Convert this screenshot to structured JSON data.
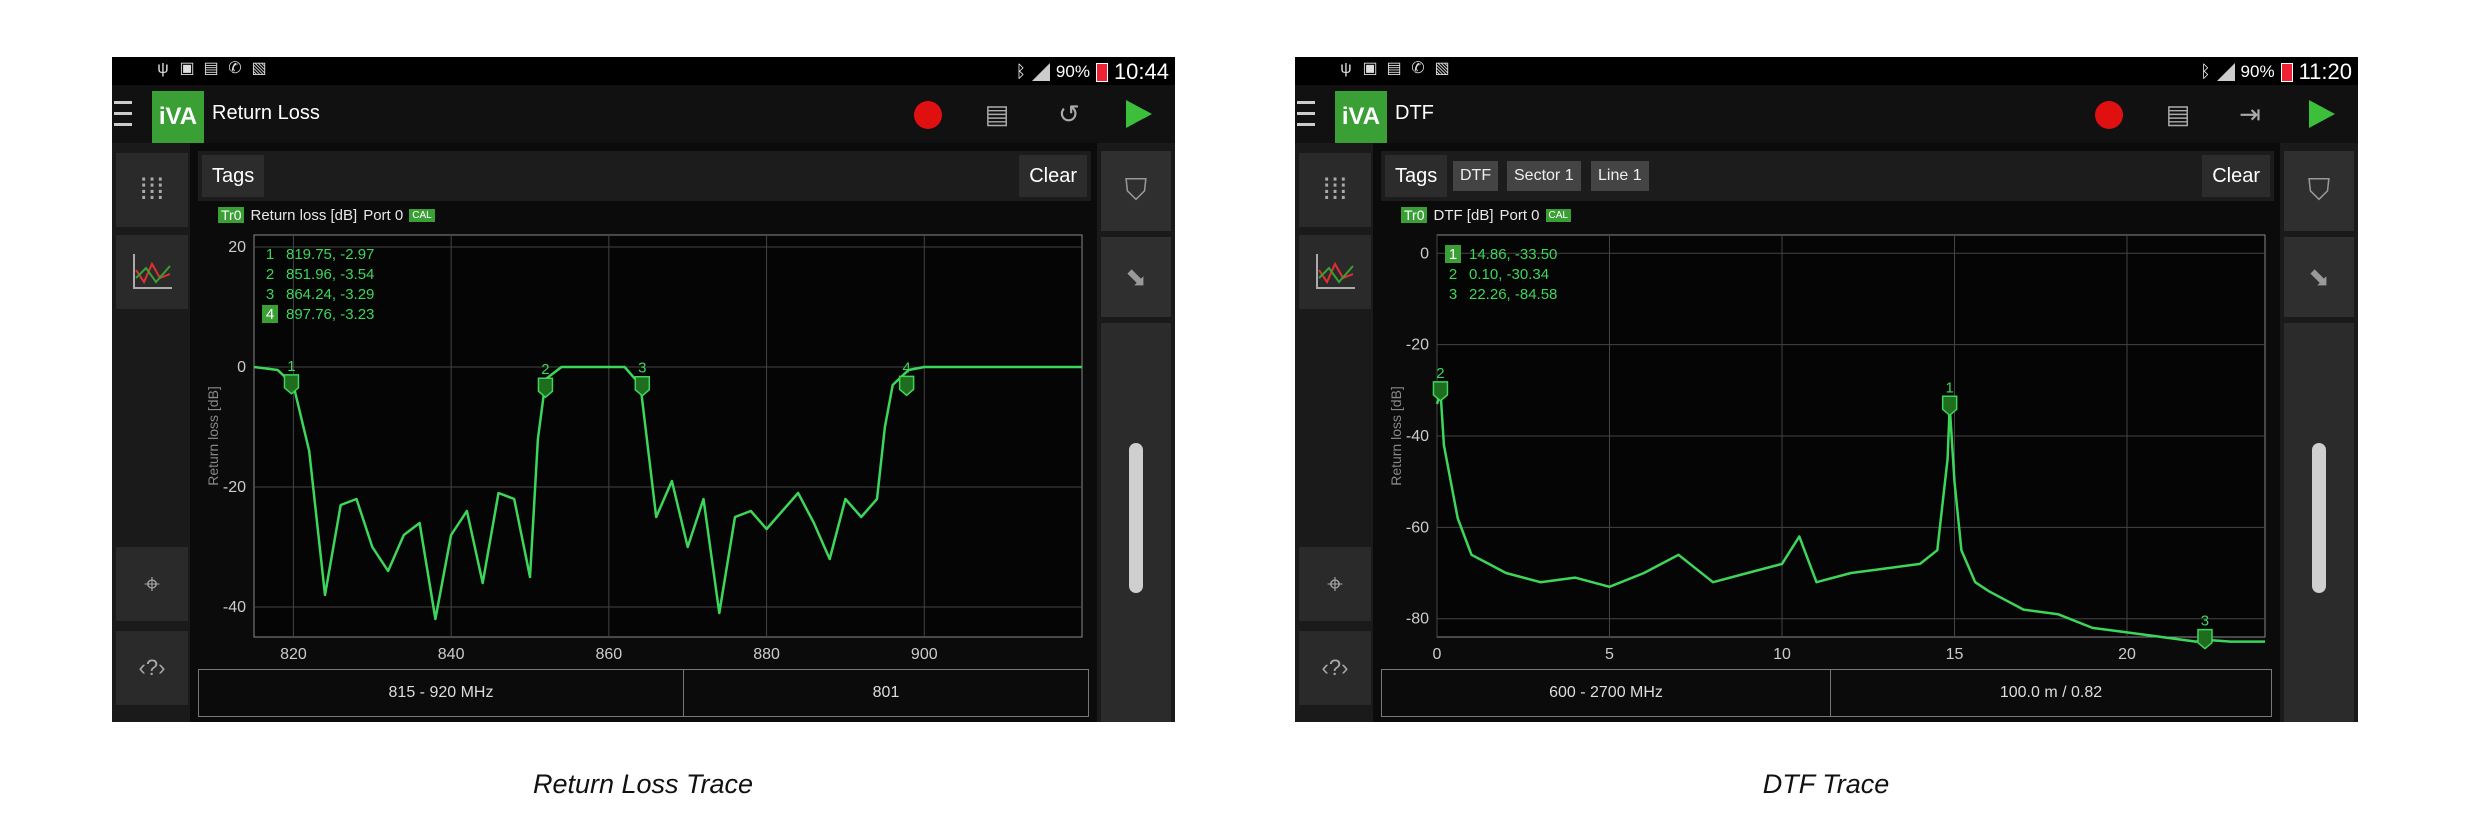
{
  "screens": [
    {
      "status": {
        "battery": "90%",
        "time": "10:44"
      },
      "title": "Return Loss",
      "tags_label": "Tags",
      "chips": [],
      "clear_label": "Clear",
      "trace_id": "Tr0",
      "trace_desc": "Return loss [dB]",
      "port": "Port 0",
      "cal": "CAL",
      "ylabel": "Return loss [dB]",
      "markers": [
        {
          "n": "1",
          "text": "819.75, -2.97",
          "active": false
        },
        {
          "n": "2",
          "text": "851.96, -3.54",
          "active": false
        },
        {
          "n": "3",
          "text": "864.24, -3.29",
          "active": false
        },
        {
          "n": "4",
          "text": "897.76, -3.23",
          "active": true
        }
      ],
      "freq_range": "815 - 920 MHz",
      "points": "801",
      "caption": "Return Loss Trace",
      "icons": [
        "menu-icon",
        "app-logo",
        "record-icon",
        "data-icon",
        "history-icon",
        "play-icon"
      ]
    },
    {
      "status": {
        "battery": "90%",
        "time": "11:20"
      },
      "title": "DTF",
      "tags_label": "Tags",
      "chips": [
        "DTF",
        "Sector 1",
        "Line 1"
      ],
      "clear_label": "Clear",
      "trace_id": "Tr0",
      "trace_desc": "DTF [dB]",
      "port": "Port 0",
      "cal": "CAL",
      "ylabel": "Return loss [dB]",
      "markers": [
        {
          "n": "1",
          "text": "14.86, -33.50",
          "active": true
        },
        {
          "n": "2",
          "text": "0.10, -30.34",
          "active": false
        },
        {
          "n": "3",
          "text": "22.26, -84.58",
          "active": false
        }
      ],
      "freq_range": "600 - 2700 MHz",
      "points": "100.0 m / 0.82",
      "caption": "DTF Trace",
      "icons": [
        "menu-icon",
        "app-logo",
        "record-icon",
        "data-icon",
        "arrow-right-bar-icon",
        "play-icon"
      ]
    }
  ],
  "logo_text": "iVA",
  "colors": {
    "trace": "#3dd65a",
    "accent": "#3aa035",
    "record": "#e01010",
    "background": "#0b0b0b"
  },
  "chart_data": [
    {
      "type": "line",
      "ylabel": "Return loss [dB]",
      "xlim": [
        815,
        920
      ],
      "ylim": [
        -45,
        22
      ],
      "xticks": [
        820,
        840,
        860,
        880,
        900
      ],
      "yticks": [
        20,
        0,
        -20,
        -40
      ],
      "grid": true,
      "series": [
        {
          "x": [
            815,
            818,
            820,
            822,
            824,
            826,
            828,
            830,
            832,
            834,
            836,
            838,
            840,
            842,
            844,
            846,
            848,
            850,
            851,
            852,
            854,
            856,
            858,
            860,
            862,
            864,
            865,
            866,
            868,
            870,
            872,
            874,
            876,
            878,
            880,
            882,
            884,
            886,
            888,
            890,
            892,
            894,
            895,
            896,
            898,
            900,
            905,
            910,
            915,
            920
          ],
          "y": [
            0,
            -0.5,
            -3,
            -14,
            -38,
            -23,
            -22,
            -30,
            -34,
            -28,
            -26,
            -42,
            -28,
            -24,
            -36,
            -21,
            -22,
            -35,
            -12,
            -2,
            0,
            0,
            0,
            0,
            0,
            -3,
            -14,
            -25,
            -19,
            -30,
            -22,
            -41,
            -25,
            -24,
            -27,
            -24,
            -21,
            -26,
            -32,
            -22,
            -25,
            -22,
            -10,
            -3,
            -0.5,
            0,
            0,
            0,
            0,
            0
          ]
        }
      ],
      "markers": [
        {
          "n": 1,
          "x": 819.75,
          "y": -2.97
        },
        {
          "n": 2,
          "x": 851.96,
          "y": -3.54
        },
        {
          "n": 3,
          "x": 864.24,
          "y": -3.29
        },
        {
          "n": 4,
          "x": 897.76,
          "y": -3.23
        }
      ]
    },
    {
      "type": "line",
      "ylabel": "Return loss [dB]",
      "xlim": [
        0,
        24
      ],
      "ylim": [
        -84,
        4
      ],
      "xticks": [
        0,
        5,
        10,
        15,
        20
      ],
      "yticks": [
        0,
        -20,
        -40,
        -60,
        -80
      ],
      "grid": true,
      "series": [
        {
          "x": [
            0,
            0.1,
            0.2,
            0.4,
            0.6,
            0.8,
            1,
            1.5,
            2,
            3,
            4,
            5,
            6,
            7,
            8,
            9,
            10,
            10.5,
            11,
            12,
            13,
            14,
            14.5,
            14.8,
            14.86,
            15,
            15.2,
            15.6,
            16,
            17,
            18,
            19,
            20,
            21,
            22,
            22.26,
            23,
            24
          ],
          "y": [
            -33,
            -30.3,
            -42,
            -50,
            -58,
            -62,
            -66,
            -68,
            -70,
            -72,
            -71,
            -73,
            -70,
            -66,
            -72,
            -70,
            -68,
            -62,
            -72,
            -70,
            -69,
            -68,
            -65,
            -45,
            -33.5,
            -50,
            -65,
            -72,
            -74,
            -78,
            -79,
            -82,
            -83,
            -84,
            -85,
            -84.6,
            -85,
            -85
          ]
        }
      ],
      "markers": [
        {
          "n": 1,
          "x": 14.86,
          "y": -33.5
        },
        {
          "n": 2,
          "x": 0.1,
          "y": -30.34
        },
        {
          "n": 3,
          "x": 22.26,
          "y": -84.58
        }
      ]
    }
  ]
}
